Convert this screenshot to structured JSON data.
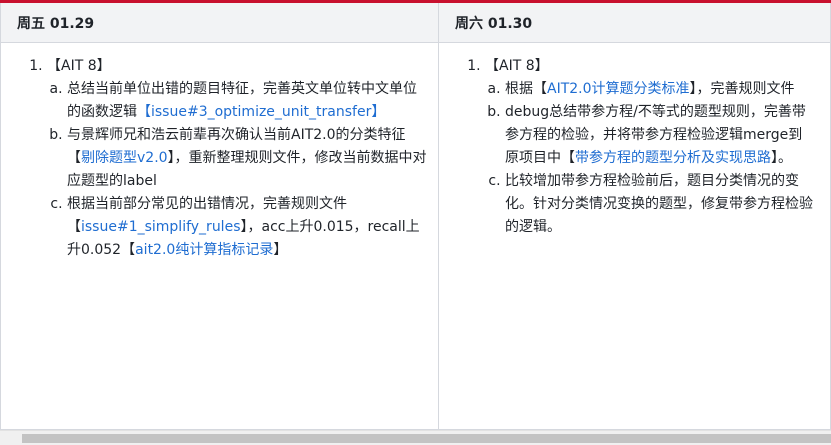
{
  "columns": [
    {
      "header": "周五 01.29",
      "item_label": "【AIT 8】",
      "subitems": [
        {
          "segments": [
            {
              "text": "总结当前单位出错的题目特征，完善英文单位转中文单位的函数逻辑"
            },
            {
              "text": "【issue#3_optimize_unit_transfer】",
              "link": true
            }
          ]
        },
        {
          "segments": [
            {
              "text": "与景辉师兄和浩云前辈再次确认当前AIT2.0的分类特征【"
            },
            {
              "text": "剔除题型v2.0",
              "link": true
            },
            {
              "text": "】，重新整理规则文件，修改当前数据中对应题型的label"
            }
          ]
        },
        {
          "segments": [
            {
              "text": "根据当前部分常见的出错情况，完善规则文件【"
            },
            {
              "text": "issue#1_simplify_rules",
              "link": true
            },
            {
              "text": "】，acc上升0.015，recall上升0.052【"
            },
            {
              "text": "ait2.0纯计算指标记录",
              "link": true
            },
            {
              "text": "】"
            }
          ]
        }
      ]
    },
    {
      "header": "周六 01.30",
      "item_label": "【AIT 8】",
      "subitems": [
        {
          "segments": [
            {
              "text": "根据【"
            },
            {
              "text": "AIT2.0计算题分类标准",
              "link": true
            },
            {
              "text": "】，完善规则文件"
            }
          ]
        },
        {
          "segments": [
            {
              "text": "debug总结带参方程/不等式的题型规则，完善带参方程的检验，并将带参方程检验逻辑merge到原项目中【"
            },
            {
              "text": "带参方程的题型分析及实现思路",
              "link": true
            },
            {
              "text": "】。"
            }
          ]
        },
        {
          "segments": [
            {
              "text": "比较增加带参方程检验前后，题目分类情况的变化。针对分类情况变换的题型，修复带参方程检验的逻辑。"
            }
          ]
        }
      ]
    }
  ],
  "colors": {
    "link": "#1f6dd1",
    "header_bg": "#f2f3f5",
    "top_accent": "#c8102e",
    "border": "#d5d8de"
  }
}
